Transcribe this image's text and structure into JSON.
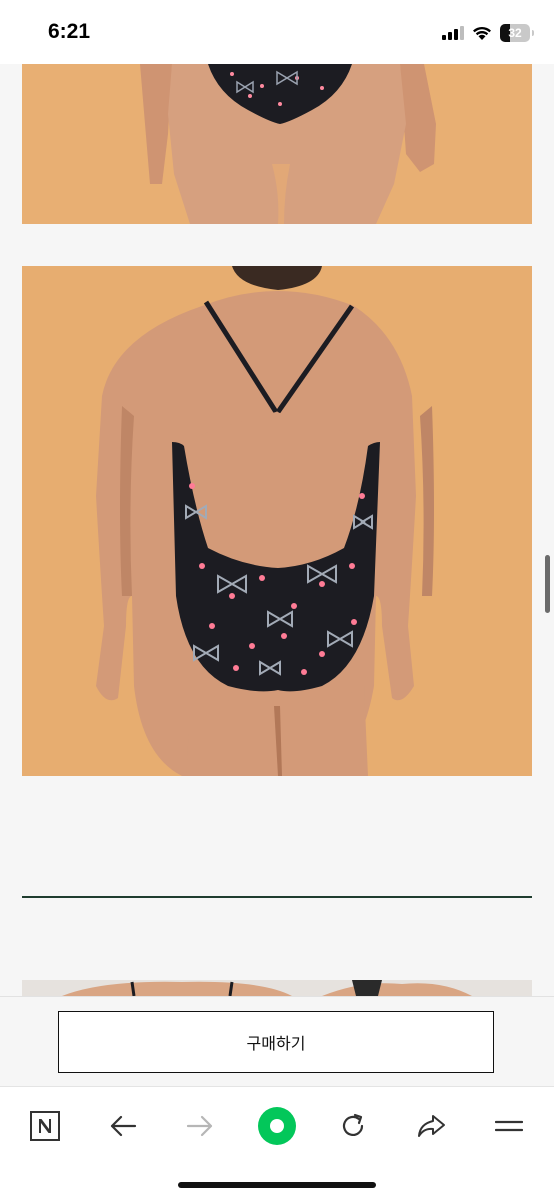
{
  "status_bar": {
    "time": "6:21",
    "battery_level": "32",
    "battery_fraction": 0.32,
    "icons": [
      "cellular-signal-icon",
      "wifi-icon",
      "battery-icon"
    ]
  },
  "main": {
    "images": [
      {
        "name": "product-photo-front-crop",
        "description_icon": "image"
      },
      {
        "name": "product-photo-back",
        "description_icon": "image"
      },
      {
        "name": "product-photo-next",
        "description_icon": "image"
      }
    ]
  },
  "purchase": {
    "button_label": "구매하기"
  },
  "toolbar": {
    "items": [
      "naver-home-icon",
      "back-arrow-icon",
      "forward-arrow-icon",
      "green-dot-icon",
      "reload-icon",
      "share-icon",
      "menu-icon"
    ],
    "accent": "#03c75a"
  },
  "colors": {
    "photo_background": "#e7ad70",
    "swimsuit": "#1c1c22",
    "skin": "#d39a78",
    "divider": "#1f3d2f"
  }
}
